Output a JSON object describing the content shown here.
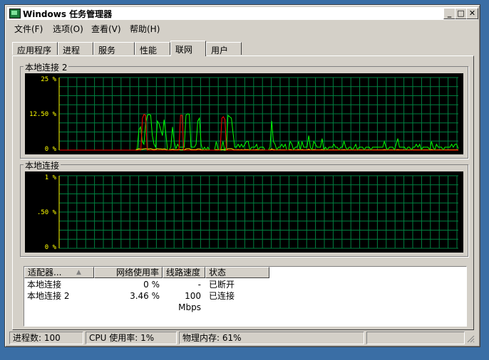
{
  "window": {
    "title": "Windows 任务管理器",
    "minimize_label": "_",
    "maximize_label": "□",
    "close_label": "✕"
  },
  "menu": [
    "文件(F)",
    "选项(O)",
    "查看(V)",
    "帮助(H)"
  ],
  "tabs": [
    "应用程序",
    "进程",
    "服务",
    "性能",
    "联网",
    "用户"
  ],
  "active_tab": "联网",
  "graphs": [
    {
      "name": "本地连接 2",
      "ticks": [
        "25 %",
        "12.50 %",
        "0 %"
      ],
      "max": 25,
      "series": [
        {
          "color": "#00ff00",
          "values": [
            0,
            0,
            0,
            0,
            0,
            0,
            0,
            0,
            0,
            0,
            0,
            0,
            0,
            0,
            0,
            0,
            0,
            0,
            0,
            0,
            0,
            0,
            0,
            0,
            0,
            0,
            0,
            0,
            0,
            0,
            0,
            0,
            0,
            0,
            0,
            0,
            0,
            0,
            0,
            0,
            0,
            0,
            0,
            0,
            0,
            0,
            0.5,
            7,
            8,
            3,
            2,
            9,
            12,
            12.3,
            12,
            5,
            2,
            1,
            10,
            9,
            7,
            5,
            10.5,
            6,
            0,
            0,
            1,
            8,
            3,
            0.5,
            2,
            1,
            1,
            1,
            1,
            12,
            12.5,
            12.3,
            1,
            1,
            1,
            2,
            10,
            11,
            2,
            0,
            1,
            0,
            1,
            0,
            0,
            0,
            0,
            3,
            0.5,
            0,
            0.5,
            3,
            0,
            1,
            12,
            11.5,
            11,
            6,
            1,
            1,
            2,
            1,
            2,
            1,
            2,
            3,
            3,
            0,
            1,
            1,
            1,
            2,
            0,
            1,
            1,
            1,
            0,
            0,
            0,
            1,
            10,
            3,
            2,
            0,
            1,
            1,
            2,
            1,
            2,
            0,
            0,
            3,
            2,
            0,
            1,
            1,
            3,
            0,
            3,
            1,
            1,
            1,
            5,
            1,
            0,
            3,
            2,
            1,
            1,
            1,
            4,
            0,
            1,
            0,
            1,
            1,
            1,
            2,
            1,
            1,
            0,
            1,
            1,
            3,
            1,
            0,
            1,
            1,
            0,
            1,
            2,
            0,
            1,
            1,
            1,
            0,
            1,
            1,
            1,
            0,
            1,
            1,
            1,
            1,
            1,
            1,
            1,
            3,
            1,
            0,
            1,
            1,
            1,
            0,
            2,
            4,
            1,
            1,
            1,
            1,
            0,
            1,
            1,
            0,
            1,
            1,
            2,
            1,
            2,
            0,
            1,
            1,
            1,
            1,
            0,
            3,
            1,
            0,
            2,
            1,
            1,
            1,
            0,
            1,
            1,
            1,
            1,
            2,
            1,
            2,
            2,
            0.5
          ]
        },
        {
          "color": "#ffff00",
          "values": [
            0,
            0,
            0,
            0,
            0,
            0,
            0,
            0,
            0,
            0,
            0,
            0,
            0,
            0,
            0,
            0,
            0,
            0,
            0,
            0,
            0,
            0,
            0,
            0,
            0,
            0,
            0,
            0,
            0,
            0,
            0,
            0,
            0,
            0,
            0,
            0,
            0,
            0,
            0,
            0,
            0,
            0,
            0,
            0,
            0,
            0,
            0.2,
            0.5,
            0.3,
            0.3,
            0.4,
            0.5,
            0.4,
            0.4,
            0.5,
            0.3,
            0.2,
            0.3,
            0.5,
            0.4,
            0.4,
            0.3,
            0.4,
            0.3,
            0,
            0,
            0.2,
            0.3,
            0.2,
            0.1,
            0.2,
            0.2,
            0.1,
            0.1,
            0.1,
            0.4,
            0.5,
            0.5,
            0.2,
            0.2,
            0.2,
            0.2,
            0.4,
            0.4,
            0.2,
            0,
            0.1,
            0,
            0.1,
            0,
            0,
            0,
            0,
            0.2,
            0.1,
            0,
            0.1,
            0.2,
            0,
            0.1,
            0.5,
            0.5,
            0.5,
            0.3,
            0.1,
            0.1,
            0.2,
            0.1,
            0.2,
            0.1,
            0.2,
            0.2,
            0.2,
            0,
            0.1,
            0.1,
            0.1,
            0.2,
            0,
            0.1,
            0.1,
            0.1,
            0,
            0,
            0,
            0.1,
            0.4,
            0.2,
            0.1,
            0,
            0.1,
            0.1,
            0.1,
            0.1,
            0.1,
            0,
            0,
            0.2,
            0.1,
            0,
            0.1,
            0.1,
            0.2,
            0,
            0.2,
            0.1,
            0.1,
            0.1,
            0.3,
            0.1,
            0,
            0.2,
            0.1,
            0.1,
            0.1,
            0.1,
            0.2,
            0,
            0.1,
            0,
            0.1,
            0.1,
            0.1,
            0.1,
            0.1,
            0.1,
            0,
            0.1,
            0.1,
            0.2,
            0.1,
            0,
            0.1,
            0.1,
            0,
            0.1,
            0.1,
            0,
            0.1,
            0.1,
            0.1,
            0,
            0.1,
            0.1,
            0.1,
            0,
            0.1,
            0.1,
            0.1,
            0.1,
            0.1,
            0.1,
            0.1,
            0.2,
            0.1,
            0,
            0.1,
            0.1,
            0.1,
            0,
            0.1,
            0.2,
            0.1,
            0.1,
            0.1,
            0.1,
            0,
            0.1,
            0.1,
            0,
            0.1,
            0.1,
            0.1,
            0.1,
            0.1,
            0,
            0.1,
            0.1,
            0.1,
            0.1,
            0,
            0.2,
            0.1,
            0,
            0.1,
            0.1,
            0.1,
            0.1,
            0,
            0.1,
            0.1,
            0.1,
            0.1,
            0.1,
            0.1,
            0.1,
            0.1,
            0.1
          ]
        },
        {
          "color": "#ff0000",
          "values": [
            0,
            0,
            0,
            0,
            0,
            0,
            0,
            0,
            0,
            0,
            0,
            0,
            0,
            0,
            0,
            0,
            0,
            0,
            0,
            0,
            0,
            0,
            0,
            0,
            0,
            0,
            0,
            0,
            0,
            0,
            0,
            0,
            0,
            0,
            0,
            0,
            0,
            0,
            0,
            0,
            0,
            0,
            0,
            0,
            0,
            0,
            0,
            0,
            0,
            0,
            0,
            0,
            11,
            12.3,
            12,
            0,
            0,
            0,
            0,
            0,
            0,
            0,
            0,
            0,
            0,
            0,
            0,
            0,
            0,
            0,
            0,
            0,
            0,
            0,
            0,
            0,
            12,
            12,
            0,
            0,
            0,
            0,
            0,
            0,
            0,
            0,
            0,
            0,
            0,
            0,
            0,
            0,
            0,
            0,
            0,
            0,
            0,
            0,
            0,
            0,
            0,
            0,
            11,
            11.5,
            10.5,
            0,
            0,
            0,
            0,
            0,
            0,
            0,
            0,
            0,
            0,
            0,
            0,
            0,
            0,
            0,
            0,
            0,
            0,
            0,
            0,
            0,
            0,
            0,
            0,
            0,
            0,
            0,
            0,
            0,
            0,
            0,
            0,
            0,
            0,
            0,
            0,
            0,
            0,
            0,
            0,
            0,
            0,
            0,
            0,
            0,
            0,
            0,
            0,
            0,
            0,
            0,
            0,
            0,
            0,
            0,
            0,
            0,
            0,
            0,
            0,
            0,
            0,
            0,
            0,
            0,
            0,
            0,
            0,
            0,
            0,
            0,
            0,
            0,
            0,
            0,
            0,
            0,
            0,
            0,
            0,
            0,
            0,
            0,
            0,
            0,
            0,
            0,
            0,
            0,
            0,
            0,
            0,
            0,
            0,
            0,
            0,
            0,
            0,
            0,
            0,
            0,
            0,
            0,
            0,
            0,
            0,
            0,
            0,
            0,
            0,
            0,
            0,
            0,
            0,
            0,
            0,
            0,
            0,
            0,
            0,
            0,
            0,
            0,
            0,
            0,
            0,
            0,
            0,
            0,
            0,
            0,
            0,
            0,
            0,
            0,
            0,
            0,
            0,
            0,
            0,
            0,
            0,
            0,
            0,
            0,
            0,
            0
          ]
        }
      ]
    },
    {
      "name": "本地连接",
      "ticks": [
        "1 %",
        ".50 %",
        "0 %"
      ],
      "max": 1,
      "series": [
        {
          "color": "#ffff00",
          "values": []
        }
      ]
    }
  ],
  "table": {
    "columns": [
      "适配器...",
      "网络使用率",
      "线路速度",
      "状态"
    ],
    "rows": [
      [
        "本地连接",
        "0 %",
        "-",
        "已断开"
      ],
      [
        "本地连接 2",
        "3.46 %",
        "100 Mbps",
        "已连接"
      ]
    ]
  },
  "status": {
    "processes": "进程数: 100",
    "cpu": "CPU 使用率: 1%",
    "memory": "物理内存: 61%"
  }
}
